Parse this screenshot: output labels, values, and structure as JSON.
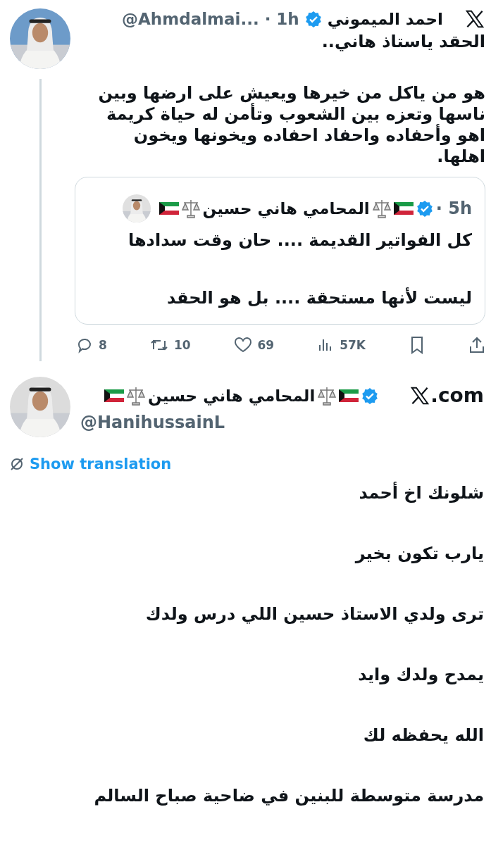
{
  "reply": {
    "name": "احمد الميموني",
    "verified": true,
    "handle": "@Ahmdalmai...",
    "time": "· 1h",
    "paragraphs": [
      [
        "الحقد ياستاذ هاني.."
      ],
      [
        "هو من ياكل من خيرها ويعيش على ارضها وبين",
        "ناسها وتعزه بين الشعوب وتأمن له حياة كريمة",
        "اهو وأحفاده واحفاد احفاده ويخونها ويخون",
        "اهلها."
      ]
    ],
    "quote": {
      "name": "المحامي هاني حسين",
      "verified": true,
      "time": "· 5h",
      "paragraphs": [
        [
          "كل الفواتير القديمة .... حان وقت سدادها"
        ],
        [
          "ليست لأنها مستحقة .... بل هو الحقد"
        ]
      ]
    },
    "actions": [
      {
        "kind": "share"
      },
      {
        "kind": "bookmark"
      },
      {
        "kind": "views",
        "count": "57K"
      },
      {
        "kind": "like",
        "count": "69"
      },
      {
        "kind": "repost",
        "count": "10"
      },
      {
        "kind": "reply",
        "count": "8"
      }
    ]
  },
  "post": {
    "name": "المحامي هاني حسين",
    "verified": true,
    "handle": "@HanihussainL",
    "site": ".com",
    "translate": "Show translation",
    "lines": [
      "شلونك اخ أحمد",
      "يارب تكون بخير",
      "ترى ولدي الاستاذ حسين اللي درس ولدك",
      "يمدح ولدك وايد",
      "الله يحفظه لك",
      "مدرسة متوسطة للبنين في ضاحية صباح السالم"
    ]
  }
}
